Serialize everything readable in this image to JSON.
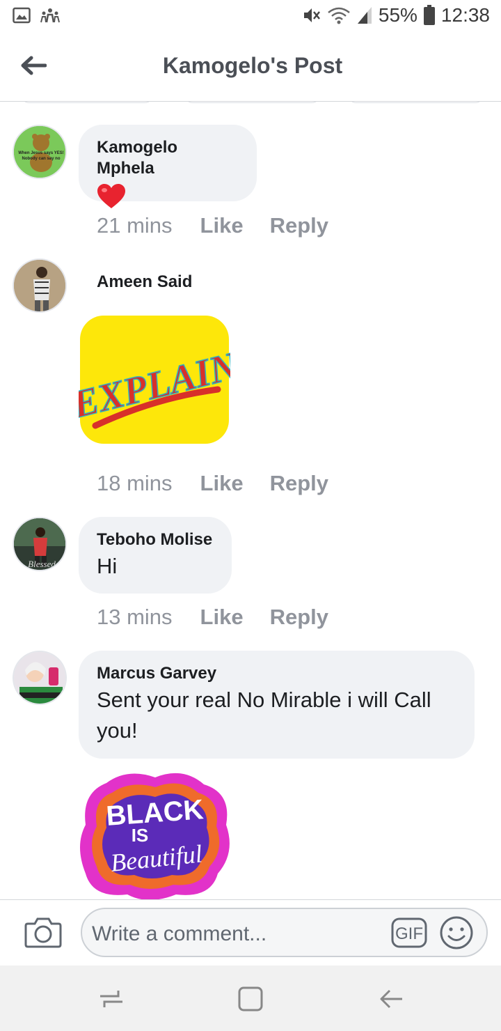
{
  "status_bar": {
    "battery_percent": "55%",
    "time": "12:38",
    "icons": [
      "gallery-icon",
      "people-icon",
      "mute-icon",
      "wifi-icon",
      "signal-icon",
      "battery-icon"
    ]
  },
  "header": {
    "title": "Kamogelo's Post"
  },
  "comments": [
    {
      "author": "Kamogelo Mphela",
      "text": "",
      "reaction": "heart-emoji",
      "avatar_text": [
        "When Jesus says YES!",
        "Nobody can say no"
      ],
      "time": "21 mins",
      "like_label": "Like",
      "reply_label": "Reply"
    },
    {
      "author": "Ameen Said",
      "sticker_text": "EXPLAIN",
      "time": "18 mins",
      "like_label": "Like",
      "reply_label": "Reply"
    },
    {
      "author": "Teboho Molise",
      "text": "Hi",
      "avatar_text": "Blessed",
      "time": "13 mins",
      "like_label": "Like",
      "reply_label": "Reply"
    },
    {
      "author": "Marcus Garvey",
      "text_line1": "Sent your real No Mirable i will Call",
      "text_line2": "you!",
      "sticker_text": [
        "BLACK",
        "IS",
        "Beautiful"
      ]
    }
  ],
  "composer": {
    "placeholder": "Write a comment...",
    "gif_label": "GIF"
  },
  "colors": {
    "bubble": "#f0f2f5",
    "meta_text": "#90949c",
    "header_text": "#4b4f56"
  }
}
